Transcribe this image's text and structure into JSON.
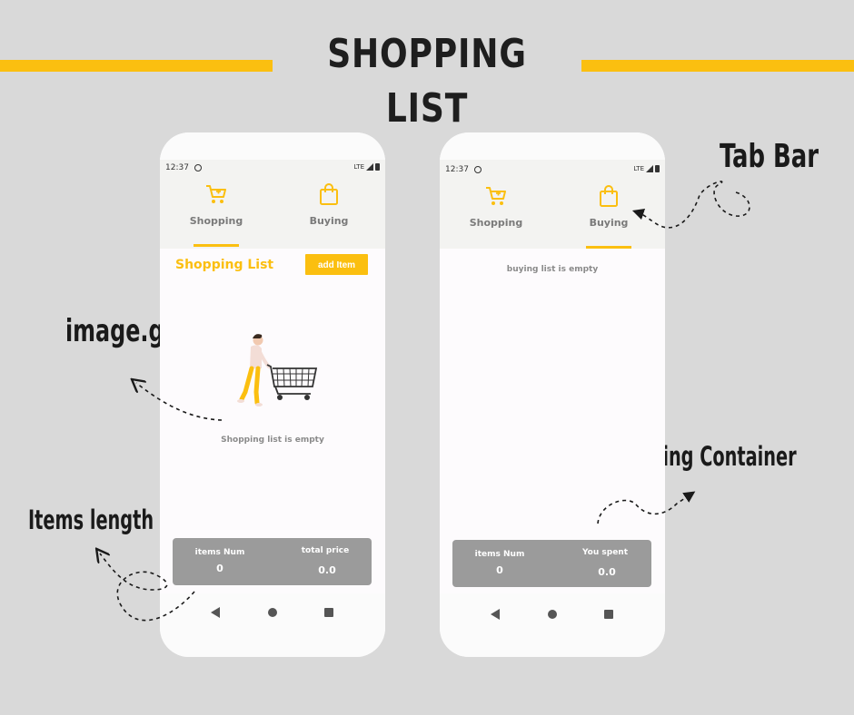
{
  "header": {
    "title": "SHOPPING LIST"
  },
  "annotations": {
    "tab_bar": "Tab Bar",
    "image_gif": "image.gif",
    "items_length": "Items length",
    "floating_container": "Floating Container"
  },
  "phone_left": {
    "status": {
      "time": "12:37",
      "network": "LTE"
    },
    "tabs": [
      {
        "label": "Shopping",
        "icon": "cart-icon"
      },
      {
        "label": "Buying",
        "icon": "bag-icon"
      }
    ],
    "active_tab": "Shopping",
    "section_title": "Shopping List",
    "add_button": "add Item",
    "empty_message": "Shopping list is empty",
    "footer": {
      "left_label": "items Num",
      "left_value": "0",
      "right_label": "total price",
      "right_value": "0.0"
    }
  },
  "phone_right": {
    "status": {
      "time": "12:37",
      "network": "LTE"
    },
    "tabs": [
      {
        "label": "Shopping",
        "icon": "cart-icon"
      },
      {
        "label": "Buying",
        "icon": "bag-icon"
      }
    ],
    "active_tab": "Buying",
    "empty_message": "buying list is empty",
    "footer": {
      "left_label": "items Num",
      "left_value": "0",
      "right_label": "You spent",
      "right_value": "0.0"
    }
  },
  "colors": {
    "accent": "#fbbf10",
    "background": "#d9d9d9",
    "floating": "#9b9b9b",
    "tab_text": "#7a7a7a"
  }
}
